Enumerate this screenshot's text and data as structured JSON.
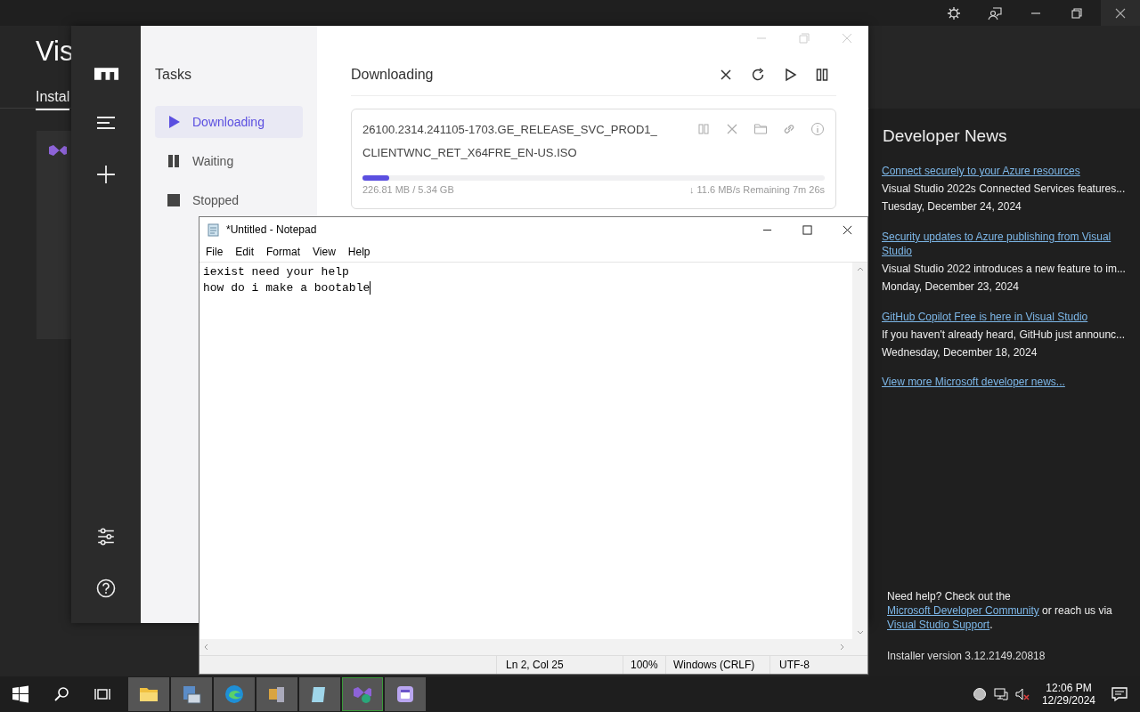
{
  "installer": {
    "title": "Vis",
    "tab": "Instal",
    "news": {
      "heading": "Developer News",
      "items": [
        {
          "title": "Connect securely to your Azure resources",
          "summary": "Visual Studio 2022s Connected Services features...",
          "date": "Tuesday, December 24, 2024"
        },
        {
          "title": "Security updates to Azure publishing from Visual Studio",
          "summary": "Visual Studio 2022 introduces a new feature to im...",
          "date": "Monday, December 23, 2024"
        },
        {
          "title": "GitHub Copilot Free is here in Visual Studio",
          "summary": "If you haven't already heard, GitHub just announc...",
          "date": "Wednesday, December 18, 2024"
        }
      ],
      "more": "View more Microsoft developer news..."
    },
    "help": [
      {
        "kind": "text",
        "text": "Need help? Check out the "
      },
      {
        "kind": "link",
        "text": "Microsoft Developer Community"
      },
      {
        "kind": "text",
        "text": " or reach us via "
      },
      {
        "kind": "link",
        "text": "Visual Studio Support"
      },
      {
        "kind": "text",
        "text": "."
      }
    ],
    "version": "Installer version 3.12.2149.20818"
  },
  "motrix": {
    "nav_title": "Tasks",
    "nav": [
      {
        "label": "Downloading",
        "kind": "play",
        "selected": true
      },
      {
        "label": "Waiting",
        "kind": "pause",
        "selected": false
      },
      {
        "label": "Stopped",
        "kind": "stop",
        "selected": false
      }
    ],
    "header": "Downloading",
    "task": {
      "name": "26100.2314.241105-1703.GE_RELEASE_SVC_PROD1_CLIENTWNC_RET_X64FRE_EN-US.ISO",
      "level": 0.058,
      "size": "226.81 MB / 5.34 GB",
      "speed": "↓ 11.6 MB/s  Remaining 7m 26s"
    }
  },
  "notepad": {
    "title": "*Untitled - Notepad",
    "menu": [
      "File",
      "Edit",
      "Format",
      "View",
      "Help"
    ],
    "lines": [
      "iexist need your help",
      "how do i make a bootable"
    ],
    "status": [
      "Ln 2, Col 25",
      "100%",
      "Windows (CRLF)",
      "UTF-8"
    ]
  },
  "clock": {
    "time": "12:06 PM",
    "date": "12/29/2024"
  }
}
